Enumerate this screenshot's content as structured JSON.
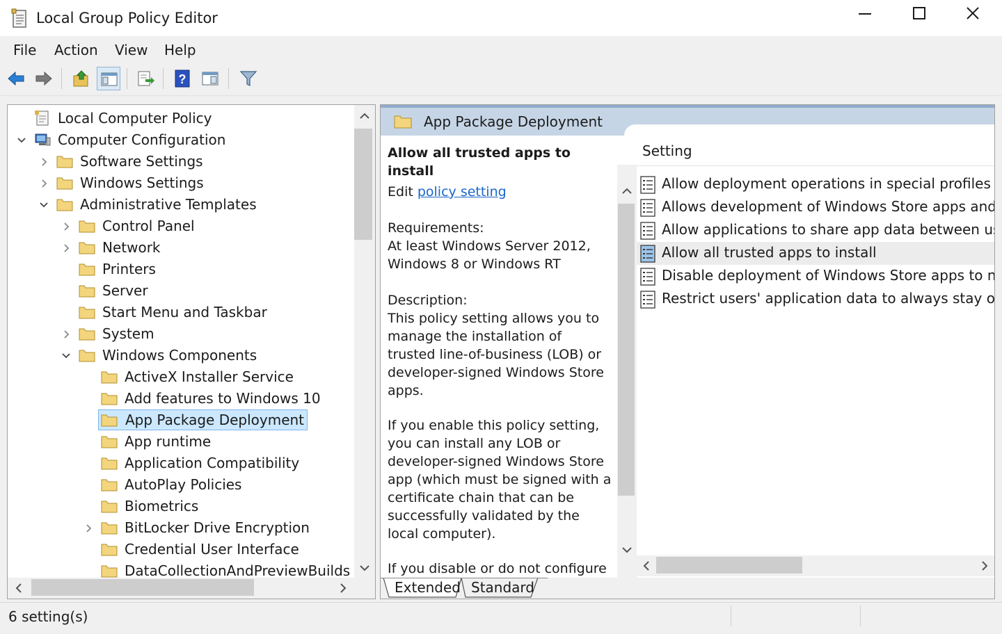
{
  "window": {
    "title": "Local Group Policy Editor"
  },
  "menu": [
    "File",
    "Action",
    "View",
    "Help"
  ],
  "toolbar": {
    "buttons": [
      "back-icon",
      "forward-icon",
      "up-folder-icon",
      "show-hide-tree-icon",
      "export-list-icon",
      "help-icon",
      "extended-view-icon",
      "filter-icon"
    ]
  },
  "tree": {
    "items": [
      {
        "label": "Local Computer Policy",
        "level": 0,
        "arrow": "none",
        "icon": "policy-doc-icon"
      },
      {
        "label": "Computer Configuration",
        "level": 0,
        "arrow": "expanded",
        "icon": "computer-icon"
      },
      {
        "label": "Software Settings",
        "level": 1,
        "arrow": "collapsed",
        "icon": "folder-icon"
      },
      {
        "label": "Windows Settings",
        "level": 1,
        "arrow": "collapsed",
        "icon": "folder-icon"
      },
      {
        "label": "Administrative Templates",
        "level": 1,
        "arrow": "expanded",
        "icon": "folder-icon"
      },
      {
        "label": "Control Panel",
        "level": 2,
        "arrow": "collapsed",
        "icon": "folder-icon"
      },
      {
        "label": "Network",
        "level": 2,
        "arrow": "collapsed",
        "icon": "folder-icon"
      },
      {
        "label": "Printers",
        "level": 2,
        "arrow": "none",
        "icon": "folder-icon"
      },
      {
        "label": "Server",
        "level": 2,
        "arrow": "none",
        "icon": "folder-icon"
      },
      {
        "label": "Start Menu and Taskbar",
        "level": 2,
        "arrow": "none",
        "icon": "folder-icon"
      },
      {
        "label": "System",
        "level": 2,
        "arrow": "collapsed",
        "icon": "folder-icon"
      },
      {
        "label": "Windows Components",
        "level": 2,
        "arrow": "expanded",
        "icon": "folder-icon"
      },
      {
        "label": "ActiveX Installer Service",
        "level": 3,
        "arrow": "none",
        "icon": "folder-icon"
      },
      {
        "label": "Add features to Windows 10",
        "level": 3,
        "arrow": "none",
        "icon": "folder-icon"
      },
      {
        "label": "App Package Deployment",
        "level": 3,
        "arrow": "none",
        "icon": "folder-icon",
        "selected": true
      },
      {
        "label": "App runtime",
        "level": 3,
        "arrow": "none",
        "icon": "folder-icon"
      },
      {
        "label": "Application Compatibility",
        "level": 3,
        "arrow": "none",
        "icon": "folder-icon"
      },
      {
        "label": "AutoPlay Policies",
        "level": 3,
        "arrow": "none",
        "icon": "folder-icon"
      },
      {
        "label": "Biometrics",
        "level": 3,
        "arrow": "none",
        "icon": "folder-icon"
      },
      {
        "label": "BitLocker Drive Encryption",
        "level": 3,
        "arrow": "collapsed",
        "icon": "folder-icon"
      },
      {
        "label": "Credential User Interface",
        "level": 3,
        "arrow": "none",
        "icon": "folder-icon"
      },
      {
        "label": "DataCollectionAndPreviewBuilds",
        "level": 3,
        "arrow": "none",
        "icon": "folder-icon"
      }
    ]
  },
  "details": {
    "header_title": "App Package Deployment",
    "extended": {
      "setting_title": "Allow all trusted apps to install",
      "edit_prefix": "Edit",
      "edit_link": "policy setting ",
      "requirements_label": "Requirements:",
      "requirements_text": "At least Windows Server 2012, Windows 8 or Windows RT",
      "description_label": "Description:",
      "description_p1": "This policy setting allows you to manage the installation of trusted line-of-business (LOB) or developer-signed Windows Store apps.",
      "description_p2": "If you enable this policy setting, you can install any LOB or developer-signed Windows Store app (which must be signed with a certificate chain that can be successfully validated by the local computer).",
      "description_p3": "If you disable or do not configure"
    },
    "list": {
      "column_header": "Setting",
      "rows": [
        {
          "label": "Allow deployment operations in special profiles"
        },
        {
          "label": "Allows development of Windows Store apps and inst"
        },
        {
          "label": "Allow applications to share app data between users"
        },
        {
          "label": "Allow all trusted apps to install",
          "selected": true
        },
        {
          "label": "Disable deployment of Windows Store apps to non-s"
        },
        {
          "label": "Restrict users' application data to always stay on the :"
        }
      ]
    },
    "tabs": [
      "Extended",
      "Standard"
    ]
  },
  "status": {
    "text": "6 setting(s)"
  }
}
